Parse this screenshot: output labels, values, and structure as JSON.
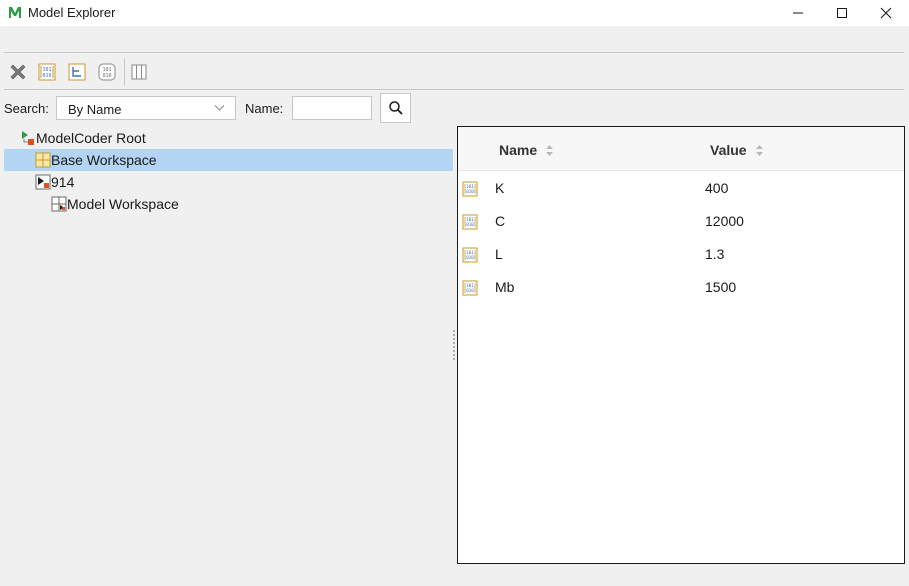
{
  "window": {
    "title": "Model Explorer",
    "app_icon": "matlab-m-icon"
  },
  "search": {
    "label": "Search:",
    "mode_value": "By Name",
    "name_label": "Name:",
    "name_value": ""
  },
  "tree": {
    "items": [
      {
        "label": "ModelCoder Root",
        "icon": "root-icon",
        "depth": 1,
        "selected": false
      },
      {
        "label": "Base Workspace",
        "icon": "workspace-grid-icon",
        "depth": 2,
        "selected": true
      },
      {
        "label": "914",
        "icon": "model-icon",
        "depth": 2,
        "selected": false
      },
      {
        "label": "Model Workspace",
        "icon": "model-workspace-icon",
        "depth": 3,
        "selected": false
      }
    ]
  },
  "table": {
    "columns": [
      "Name",
      "Value"
    ],
    "rows": [
      {
        "name": "K",
        "value": "400"
      },
      {
        "name": "C",
        "value": "12000"
      },
      {
        "name": "L",
        "value": "1.3"
      },
      {
        "name": "Mb",
        "value": "1500"
      }
    ]
  },
  "colors": {
    "selection": "#b3d4f2",
    "accent_green": "#2e9b46",
    "accent_orange": "#e0862d"
  }
}
